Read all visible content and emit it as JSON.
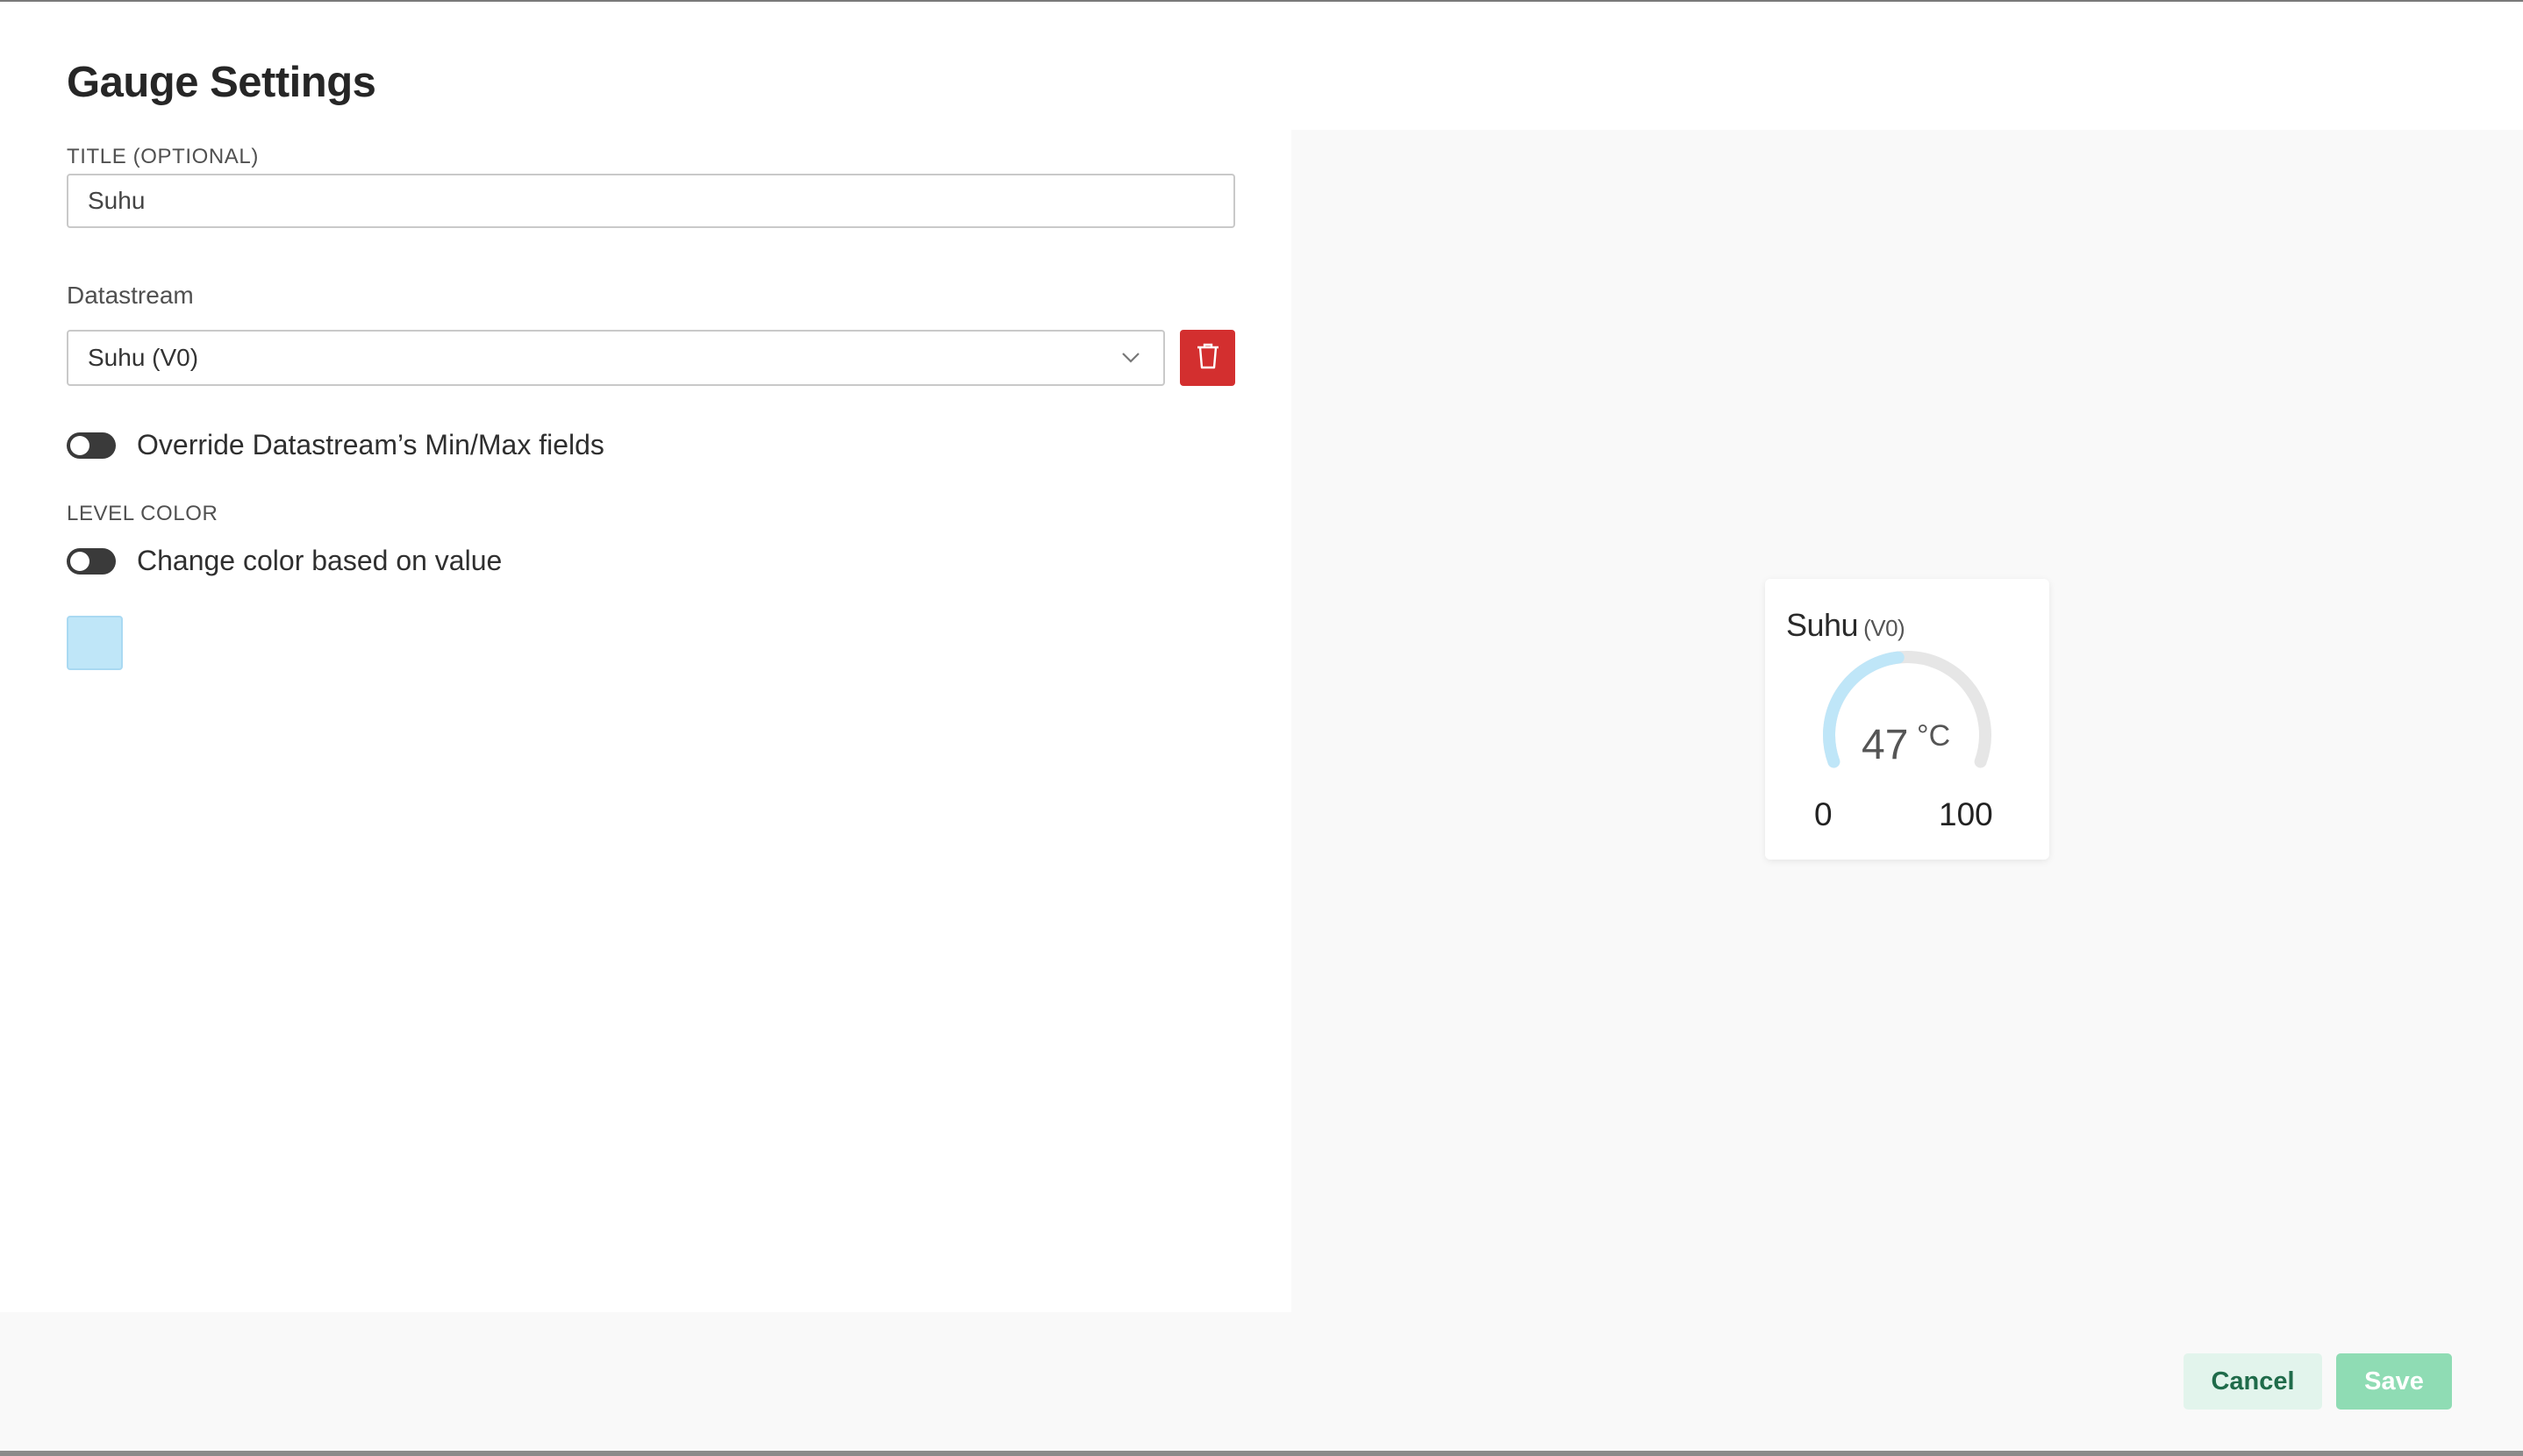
{
  "dialog": {
    "title": "Gauge Settings"
  },
  "form": {
    "title_label": "TITLE (OPTIONAL)",
    "title_value": "Suhu",
    "datastream_label": "Datastream",
    "datastream_value": "Suhu (V0)",
    "override_label": "Override Datastream’s Min/Max fields",
    "level_color_label": "LEVEL COLOR",
    "change_color_label": "Change color based on value",
    "swatch_color": "#bfe6f8"
  },
  "preview": {
    "widget_title": "Suhu",
    "widget_pin": "(V0)",
    "value": "47",
    "unit": "°C",
    "min": "0",
    "max": "100",
    "level": 0.47,
    "fill_color": "#bfe6f8",
    "track_color": "#e6e6e6"
  },
  "footer": {
    "cancel_label": "Cancel",
    "save_label": "Save"
  },
  "colors": {
    "delete_button": "#d32f2f",
    "cancel_bg": "#e2f4ec",
    "save_bg": "#8fdcb4"
  }
}
